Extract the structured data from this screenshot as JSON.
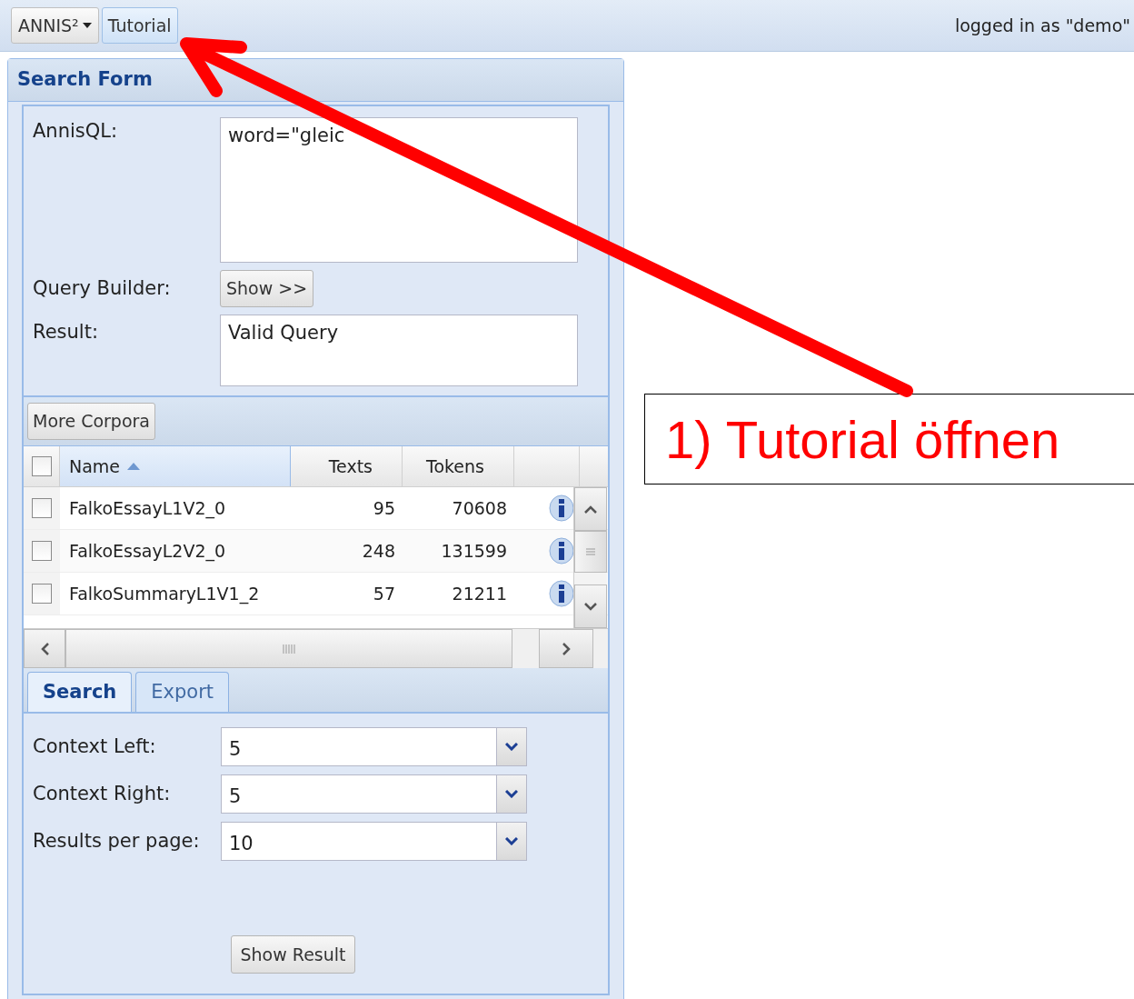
{
  "top_bar": {
    "menu_button": "ANNIS²",
    "tutorial_button": "Tutorial",
    "user_status": "logged in as \"demo\""
  },
  "search_form": {
    "title": "Search Form",
    "query": {
      "label": "AnnisQL:",
      "value": "word=\"gleic"
    },
    "query_builder": {
      "label": "Query Builder:",
      "button": "Show >>"
    },
    "result": {
      "label": "Result:",
      "value": "Valid Query"
    },
    "more_corpora_button": "More Corpora",
    "corpus_table": {
      "columns": [
        {
          "label": "Name"
        },
        {
          "label": "Texts"
        },
        {
          "label": "Tokens"
        }
      ],
      "header_checked": false,
      "rows": [
        {
          "checked": false,
          "name": "FalkoEssayL1V2_0",
          "texts": "95",
          "tokens": "70608"
        },
        {
          "checked": false,
          "name": "FalkoEssayL2V2_0",
          "texts": "248",
          "tokens": "131599"
        },
        {
          "checked": false,
          "name": "FalkoSummaryL1V1_2",
          "texts": "57",
          "tokens": "21211"
        }
      ]
    },
    "tabs": [
      {
        "label": "Search",
        "selected": true
      },
      {
        "label": "Export",
        "selected": false
      }
    ],
    "fields": [
      {
        "label": "Context Left:",
        "value": "5"
      },
      {
        "label": "Context Right:",
        "value": "5"
      },
      {
        "label": "Results per page:",
        "value": "10"
      }
    ],
    "show_result_button": "Show Result"
  },
  "annotation": {
    "text": "1) Tutorial öffnen"
  }
}
